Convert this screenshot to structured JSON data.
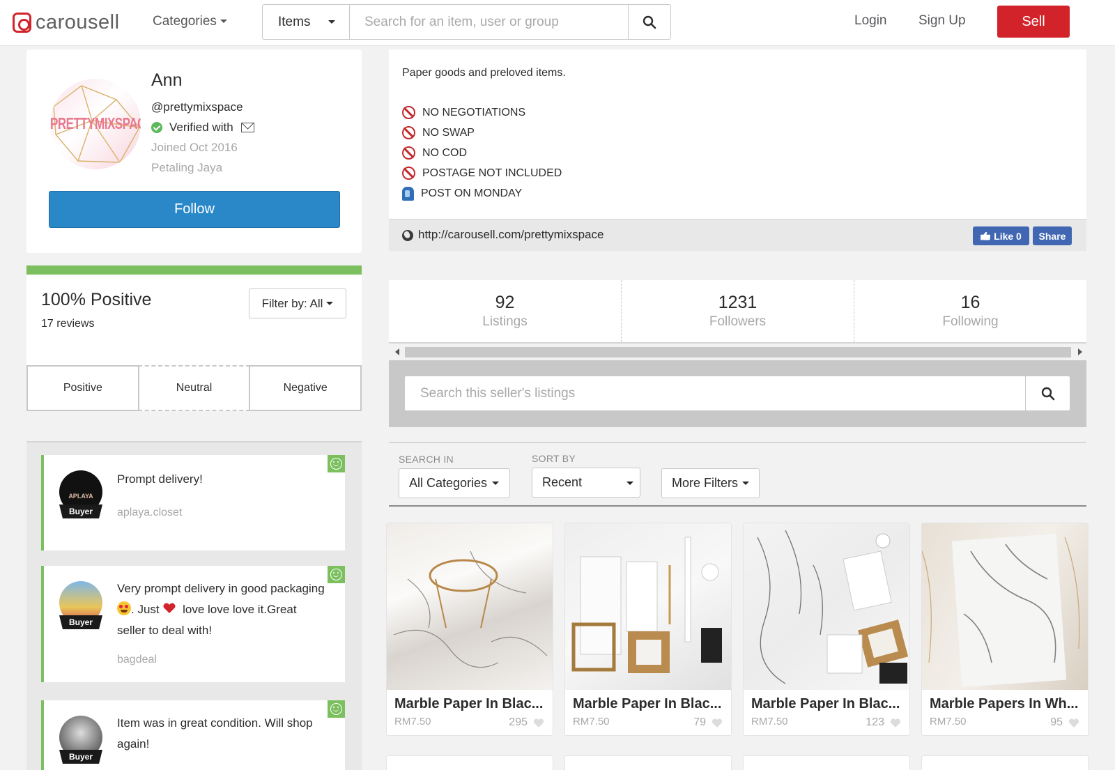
{
  "header": {
    "logo_text": "carousell",
    "categories_label": "Categories",
    "search_scope": "Items",
    "search_placeholder": "Search for an item, user or group",
    "login_label": "Login",
    "signup_label": "Sign Up",
    "sell_label": "Sell",
    "brand_color": "#d2232a"
  },
  "profile": {
    "avatar_text": "PRETTYMIXSPACE",
    "name": "Ann",
    "username": "@prettymixspace",
    "verified_label": "Verified with",
    "joined": "Joined Oct 2016",
    "location": "Petaling Jaya",
    "follow_label": "Follow"
  },
  "reviews": {
    "positive_label": "100% Positive",
    "count_label": "17 reviews",
    "filter_label": "Filter by: All",
    "tabs": [
      "Positive",
      "Neutral",
      "Negative"
    ],
    "items": [
      {
        "text": "Prompt delivery!",
        "user": "aplaya.closet",
        "role": "Buyer",
        "avatar_text": "APLAYA"
      },
      {
        "text_parts": [
          "Very prompt delivery in good packaging",
          ". Just ",
          " love love love it.Great seller to deal with!"
        ],
        "user": "bagdeal",
        "role": "Buyer"
      },
      {
        "text": "Item was in great condition. Will shop again!",
        "user": "",
        "role": "Buyer"
      }
    ]
  },
  "about": {
    "description": "Paper goods and preloved items.",
    "rules": [
      "NO NEGOTIATIONS",
      "NO SWAP",
      "NO COD",
      "POSTAGE NOT INCLUDED"
    ],
    "post_rule": "POST ON MONDAY",
    "url": "http://carousell.com/prettymixspace",
    "fb_like_label": "Like 0",
    "fb_share_label": "Share"
  },
  "stats": [
    {
      "value": "92",
      "label": "Listings"
    },
    {
      "value": "1231",
      "label": "Followers"
    },
    {
      "value": "16",
      "label": "Following"
    }
  ],
  "seller_search": {
    "placeholder": "Search this seller's listings"
  },
  "filters": {
    "search_in_label": "SEARCH IN",
    "search_in_value": "All Categories",
    "sort_by_label": "SORT BY",
    "sort_by_value": "Recent",
    "more_filters_label": "More Filters"
  },
  "listings": [
    {
      "title": "Marble Paper In Blac...",
      "price": "RM7.50",
      "likes": "295"
    },
    {
      "title": "Marble Paper In Blac...",
      "price": "RM7.50",
      "likes": "79"
    },
    {
      "title": "Marble Paper In Blac...",
      "price": "RM7.50",
      "likes": "123"
    },
    {
      "title": "Marble Papers In Wh...",
      "price": "RM7.50",
      "likes": "95"
    }
  ]
}
